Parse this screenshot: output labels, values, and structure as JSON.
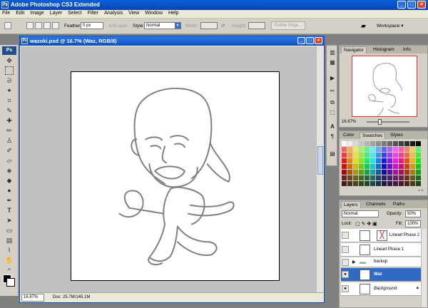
{
  "app": {
    "title": "Adobe Photoshop CS3 Extended",
    "ps_badge": "Ps",
    "window_buttons": [
      "_",
      "□",
      "×"
    ]
  },
  "menu": [
    "File",
    "Edit",
    "Image",
    "Layer",
    "Select",
    "Filter",
    "Analysis",
    "View",
    "Window",
    "Help"
  ],
  "options": {
    "feather_label": "Feather:",
    "feather_value": "0 px",
    "antialias_label": "Anti-alias",
    "style_label": "Style:",
    "style_value": "Normal",
    "width_label": "Width:",
    "height_label": "Height:",
    "refine_label": "Refine Edge...",
    "workspace_label": "Workspace ▾"
  },
  "document": {
    "title": "wazoki.psd @ 16.7% (Waz, RGB/8)",
    "zoom": "16.67%",
    "doc_info": "Doc: 25.7M/145.1M"
  },
  "navigator": {
    "tabs": [
      "Navigator",
      "Histogram",
      "Info"
    ],
    "zoom": "16.67%"
  },
  "swatches": {
    "tabs": [
      "Color",
      "Swatches",
      "Styles"
    ]
  },
  "layers": {
    "tabs": [
      "Layers",
      "Channels",
      "Paths"
    ],
    "blend_mode": "Normal",
    "opacity_label": "Opacity:",
    "opacity_value": "50%",
    "lock_label": "Lock:",
    "fill_label": "Fill:",
    "fill_value": "100%",
    "rows": [
      {
        "name": "Lineart Phase 2"
      },
      {
        "name": "Lineart Phase 1"
      },
      {
        "name": "backup"
      },
      {
        "name": "Waz"
      },
      {
        "name": "Background"
      }
    ]
  }
}
